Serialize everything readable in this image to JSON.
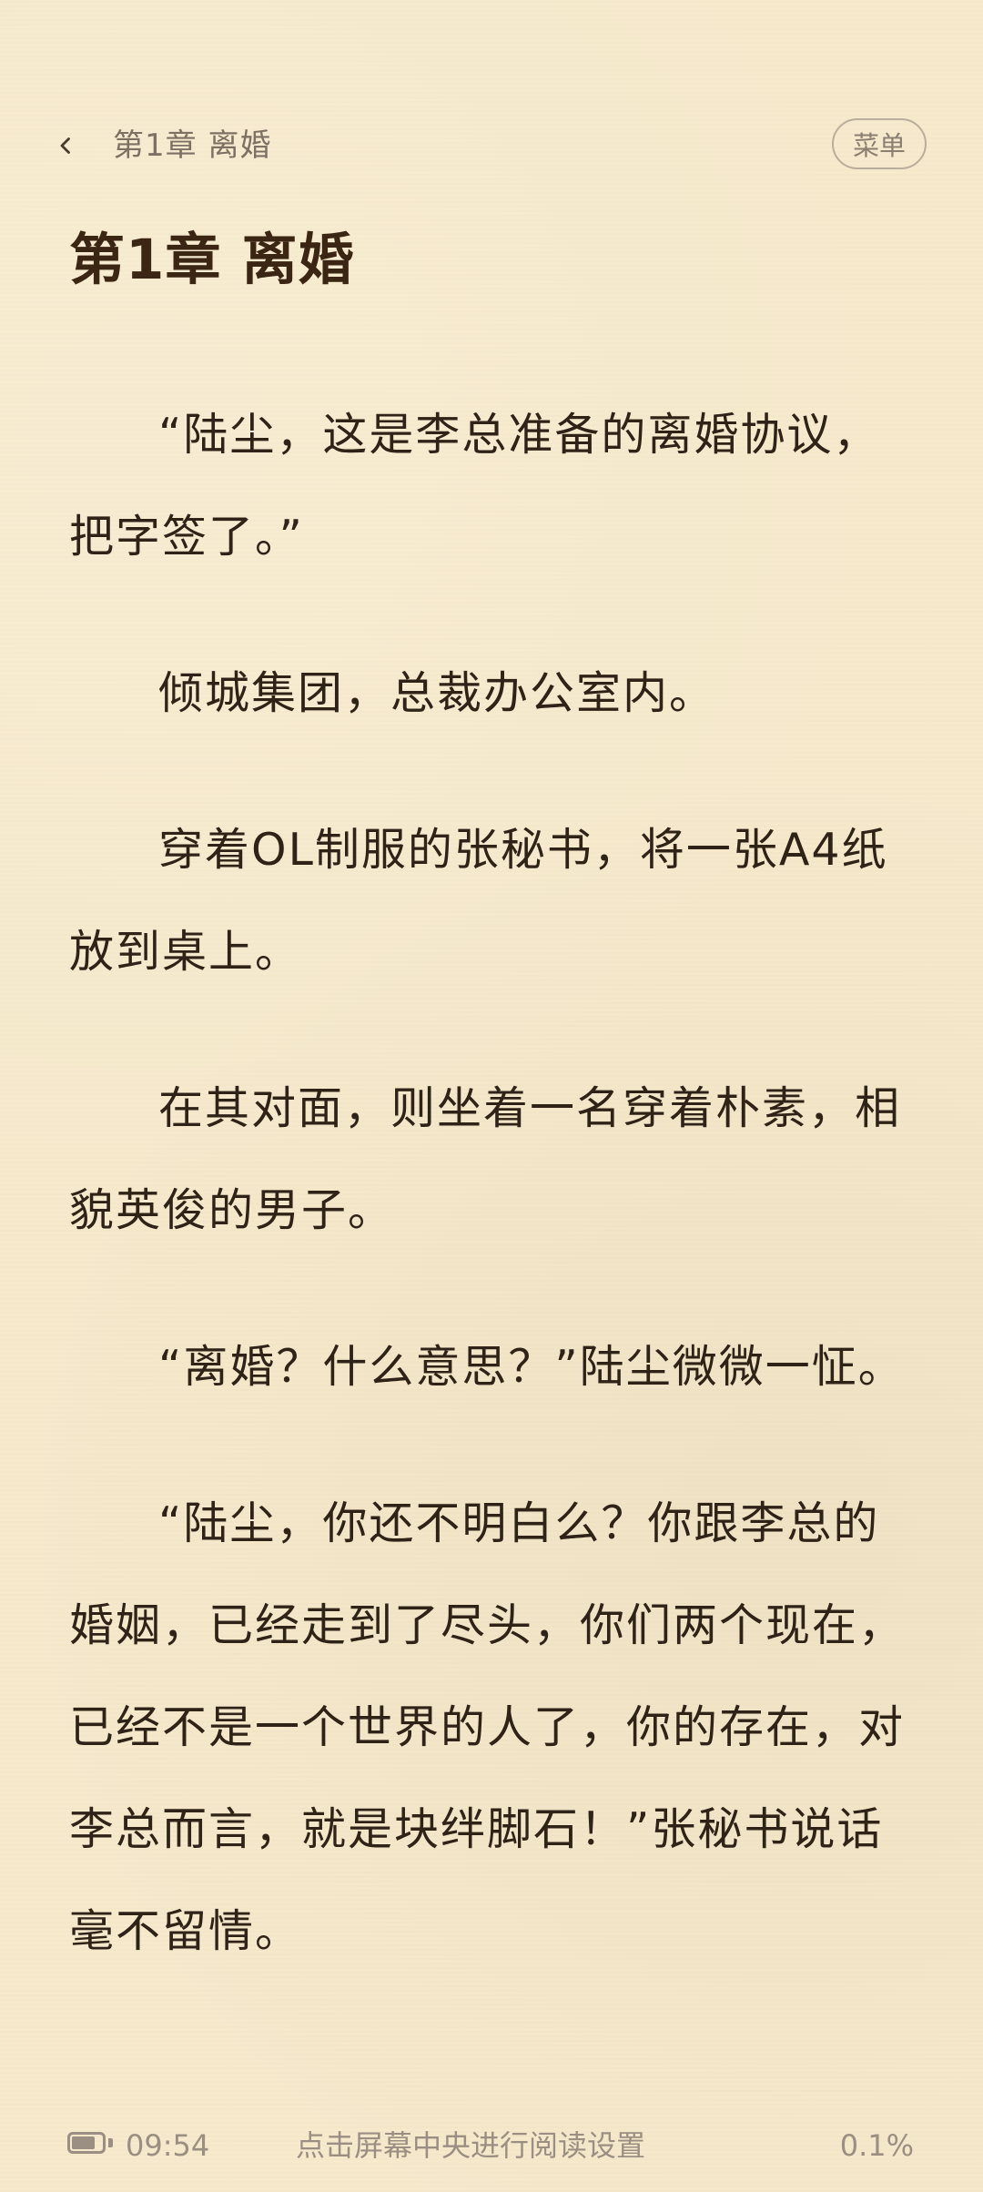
{
  "header": {
    "back_icon": "chevron-left-icon",
    "title": "第1章  离婚",
    "menu_label": "菜单"
  },
  "chapter": {
    "title": "第1章  离婚",
    "paragraphs": [
      "“陆尘，这是李总准备的离婚协议，把字签了。”",
      "倾城集团，总裁办公室内。",
      "穿着OL制服的张秘书，将一张A4纸放到桌上。",
      "在其对面，则坐着一名穿着朴素，相貌英俊的男子。",
      "“离婚？什么意思？”陆尘微微一怔。",
      "“陆尘，你还不明白么？你跟李总的婚姻，已经走到了尽头，你们两个现在，已经不是一个世界的人了，你的存在，对李总而言，就是块绊脚石！”张秘书说话毫不留情。"
    ]
  },
  "footer": {
    "battery_icon": "battery-icon",
    "battery_level_percent": 82,
    "time": "09:54",
    "hint": "点击屏幕中央进行阅读设置",
    "progress": "0.1%"
  },
  "colors": {
    "background": "#f6e9cc",
    "text": "#2f2318",
    "title": "#3b2614",
    "muted": "#8b7f72"
  }
}
